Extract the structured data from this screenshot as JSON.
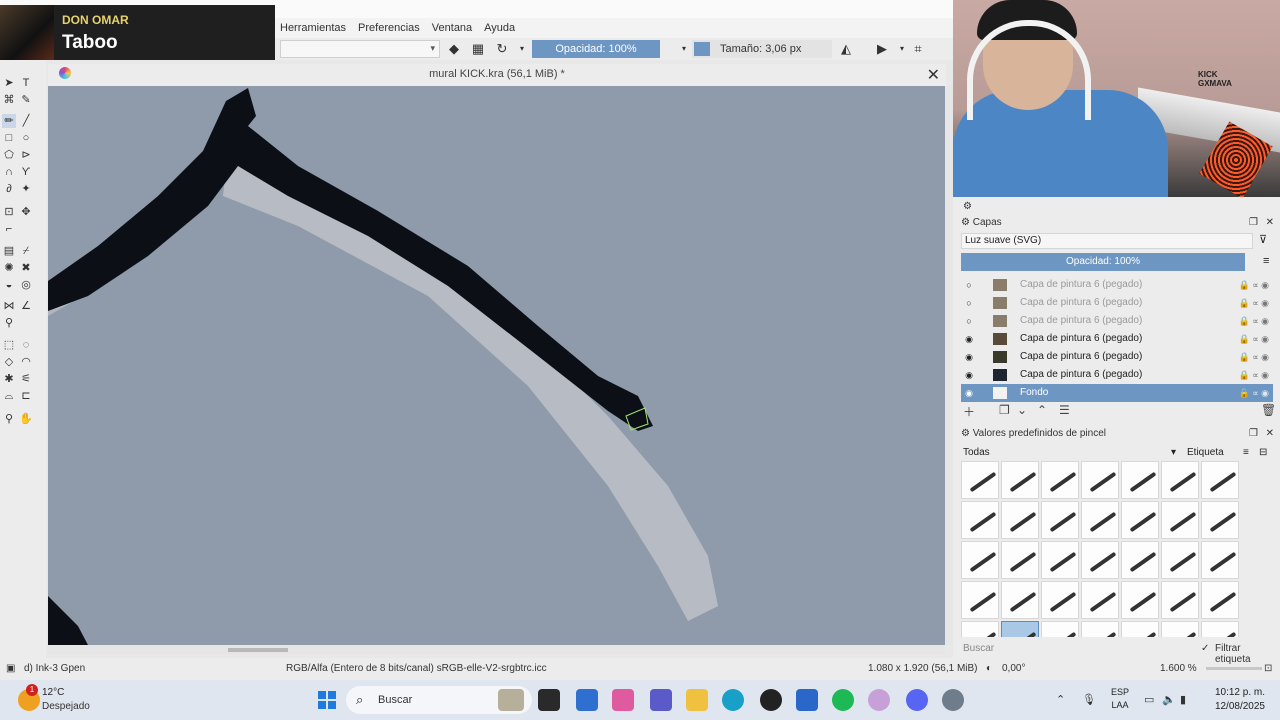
{
  "music": {
    "artist": "DON OMAR",
    "song": "Taboo"
  },
  "menu": {
    "items": [
      "Herramientas",
      "Preferencias",
      "Ventana",
      "Ayuda"
    ]
  },
  "tool_options": {
    "opacity_label": "Opacidad: 100%",
    "size_label": "Tamaño: 3,06 px"
  },
  "document": {
    "title": "mural KICK.kra (56,1 MiB) *"
  },
  "canvas": {
    "background_color": "#8f9bab",
    "stroke_color": "#0d0f16"
  },
  "status": {
    "brush_name": "d) Ink-3 Gpen",
    "color_profile": "RGB/Alfa (Entero de 8 bits/canal)  sRGB-elle-V2-srgbtrc.icc",
    "image_size": "1.080 x 1.920 (56,1 MiB)",
    "rotation": "0,00°",
    "zoom": "1.600 %"
  },
  "layers_panel": {
    "title": "Capas",
    "blend_mode": "Luz suave (SVG)",
    "opacity_label": "Opacidad:  100%",
    "layers": [
      {
        "name": "Capa de pintura 6 (pegado)",
        "visible": false
      },
      {
        "name": "Capa de pintura 6 (pegado)",
        "visible": false
      },
      {
        "name": "Capa de pintura 6 (pegado)",
        "visible": false
      },
      {
        "name": "Capa de pintura 6 (pegado)",
        "visible": true
      },
      {
        "name": "Capa de pintura 6 (pegado)",
        "visible": true
      },
      {
        "name": "Capa de pintura 6 (pegado)",
        "visible": true
      },
      {
        "name": "Fondo",
        "visible": true,
        "selected": true
      }
    ]
  },
  "brush_presets": {
    "title": "Valores predefinidos de pincel",
    "filter": "Todas",
    "tag_label": "Etiqueta",
    "search_placeholder": "Buscar",
    "filter_tag_label": "Filtrar etiqueta",
    "selected_index": 29,
    "count": 35
  },
  "taskbar": {
    "weather_temp": "12°C",
    "weather_desc": "Despejado",
    "weather_badge": "1",
    "search_label": "Buscar",
    "lang_top": "ESP",
    "lang_bottom": "LAA",
    "time": "10:12 p. m.",
    "date": "12/08/2025",
    "accent": "#1f7ae0"
  },
  "webcam": {
    "sign_text": "KICK\nGXMAVA"
  }
}
